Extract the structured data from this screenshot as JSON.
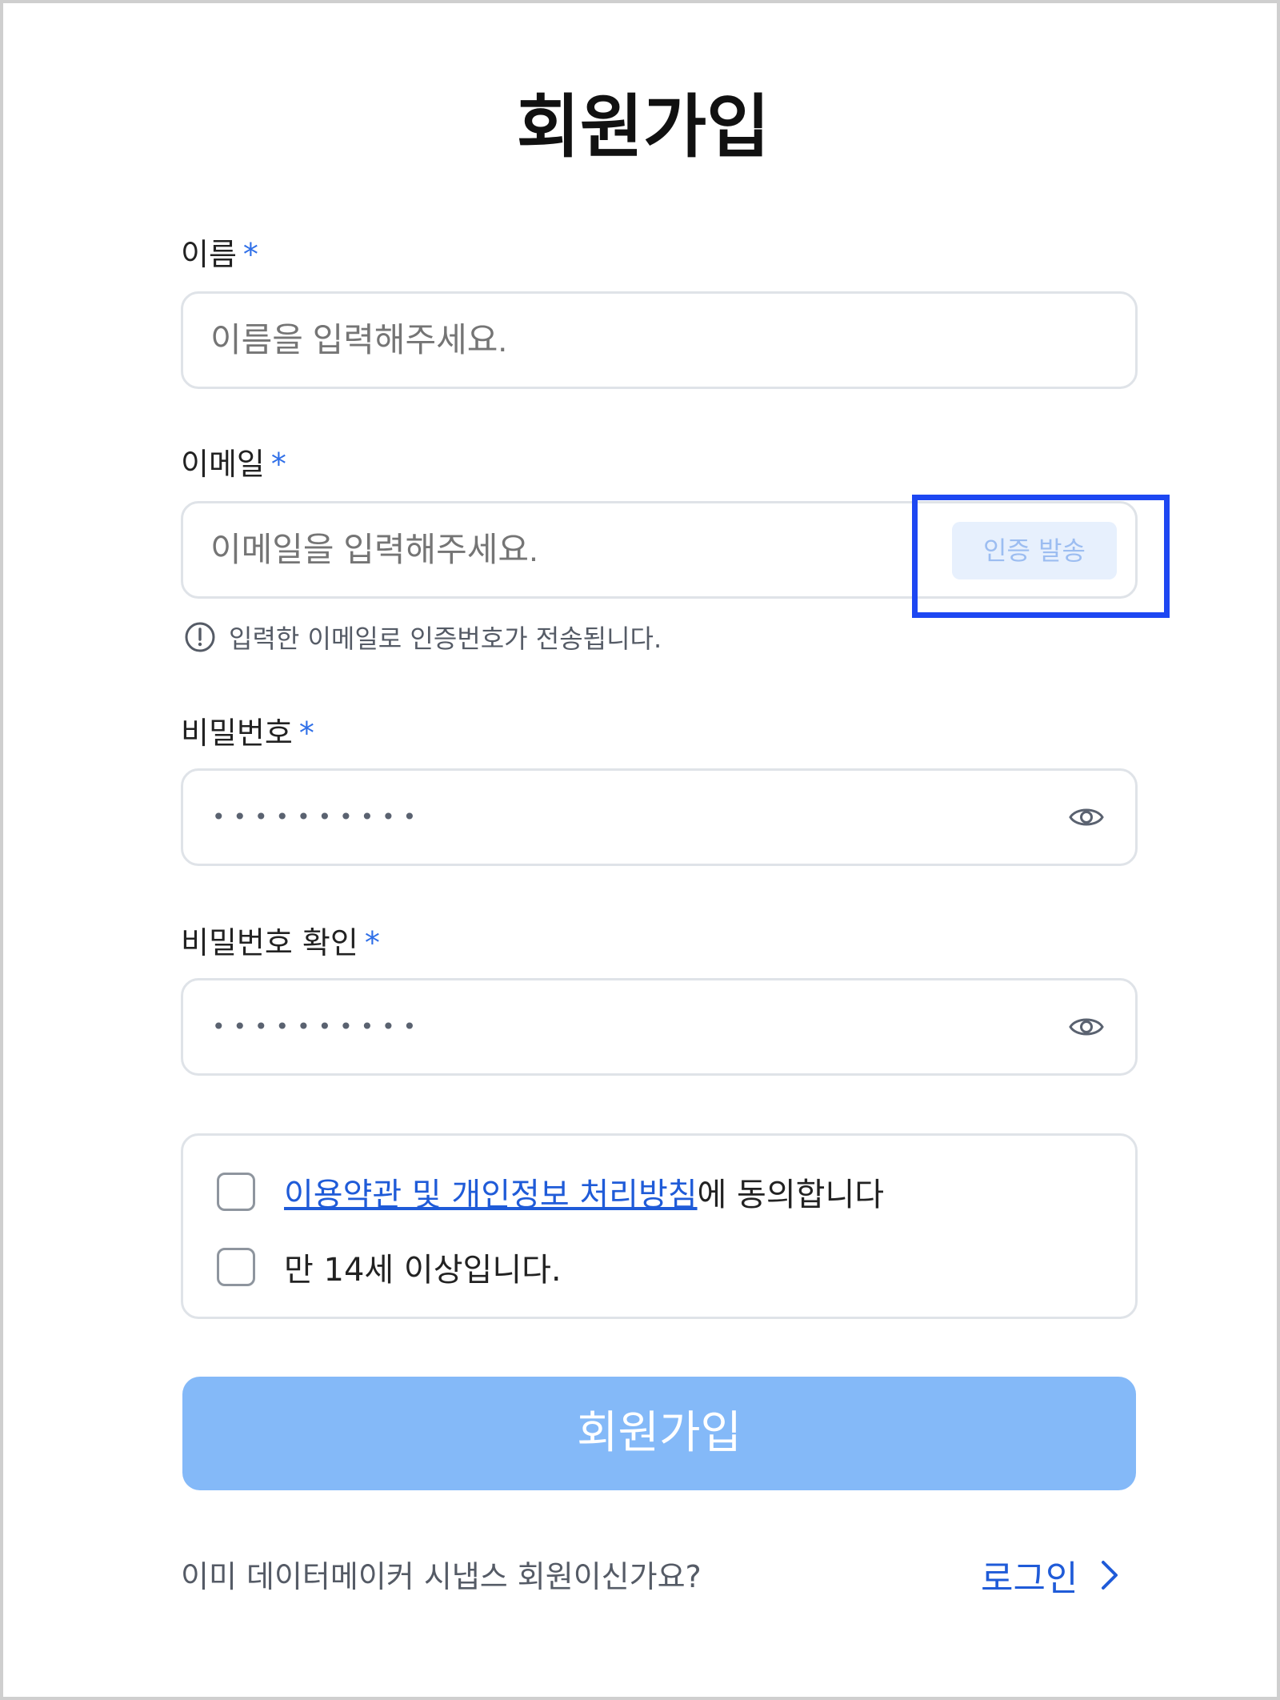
{
  "page_title": "회원가입",
  "required_mark": "*",
  "name_field": {
    "label": "이름",
    "placeholder": "이름을 입력해주세요."
  },
  "email_field": {
    "label": "이메일",
    "placeholder": "이메일을 입력해주세요.",
    "verify_button": "인증 발송",
    "hint": "입력한 이메일로 인증번호가 전송됩니다."
  },
  "password_field": {
    "label": "비밀번호",
    "masked_value": "••••••••••"
  },
  "password_confirm_field": {
    "label": "비밀번호 확인",
    "masked_value": "••••••••••"
  },
  "agreements": {
    "terms_link": "이용약관 및 개인정보 처리방침",
    "terms_suffix": "에 동의합니다",
    "age_label": "만 14세 이상입니다."
  },
  "submit_button": "회원가입",
  "footer": {
    "question": "이미 데이터메이커 시냅스 회원이신가요?",
    "login_link": "로그인"
  },
  "icons": {
    "eye": "eye-icon",
    "info": "info-icon",
    "chevron": "chevron-right-icon"
  },
  "colors": {
    "accent": "#1f5bd8",
    "required": "#2f6fe8",
    "submit_disabled": "#84b9f8",
    "verify_bg": "#e7f0fd",
    "highlight": "#1d47f2"
  }
}
